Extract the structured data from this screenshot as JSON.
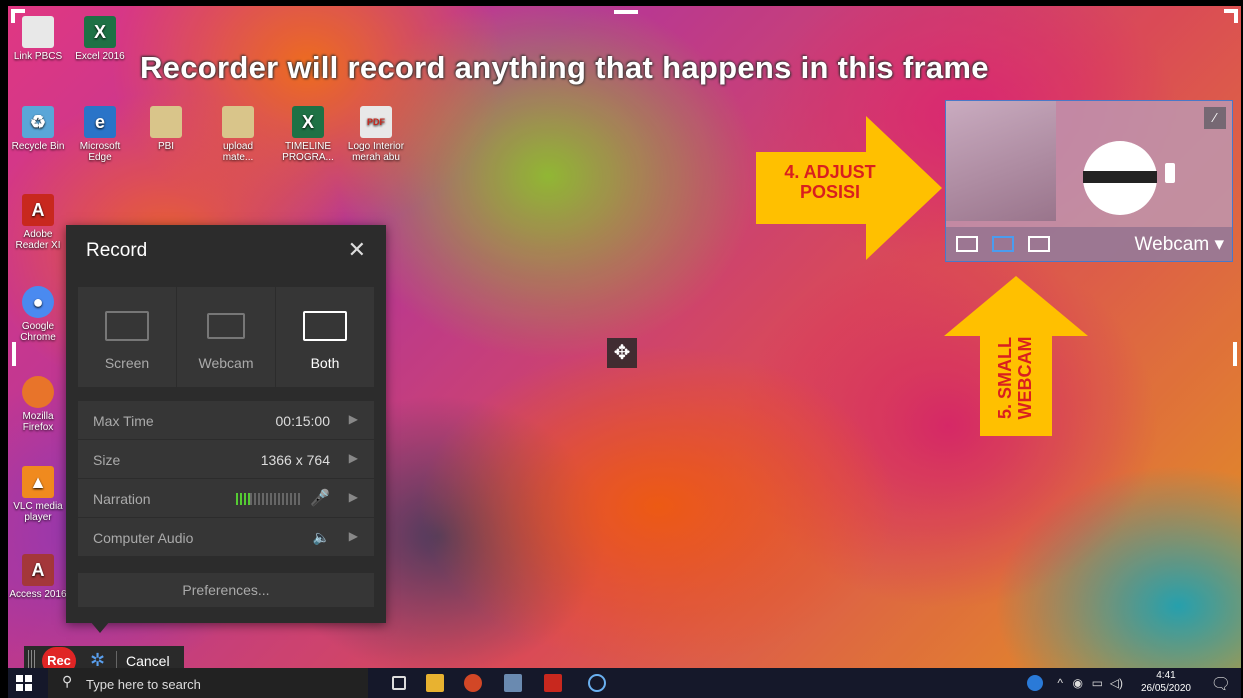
{
  "overlay_hint": "Recorder will record anything that happens in this frame",
  "desktop_icons": [
    {
      "label": "Link PBCS",
      "color": "#e8e8e8"
    },
    {
      "label": "Excel 2016",
      "color": "#1e7145"
    },
    {
      "label": "Recycle Bin",
      "color": "#5aa6d8"
    },
    {
      "label": "Microsoft Edge",
      "color": "#2a74c8"
    },
    {
      "label": "PBI",
      "color": "#d9c58a"
    },
    {
      "label": "upload mate...",
      "color": "#d9c58a"
    },
    {
      "label": "TIMELINE PROGRA...",
      "color": "#1e7145"
    },
    {
      "label": "Logo Interior merah abu",
      "color": "#e8e8e8"
    },
    {
      "label": "Adobe Reader XI",
      "color": "#c8281e"
    },
    {
      "label": "Google Chrome",
      "color": "#4a8af0"
    },
    {
      "label": "Mozilla Firefox",
      "color": "#e8742a"
    },
    {
      "label": "VLC media player",
      "color": "#f08a1e"
    },
    {
      "label": "Access 2016",
      "color": "#a4373a"
    }
  ],
  "webcam_preview": {
    "label": "Webcam",
    "dropdown_glyph": "▾",
    "wand_glyph": "⁄"
  },
  "annotations": {
    "adjust": "4. ADJUST POSISI",
    "small": "5. SMALL WEBCAM",
    "arrow_color": "#ffc000",
    "text_color": "#d91f1f"
  },
  "move_glyph": "✥",
  "record_panel": {
    "title": "Record",
    "close_glyph": "✕",
    "modes": [
      {
        "label": "Screen",
        "selected": false
      },
      {
        "label": "Webcam",
        "selected": false
      },
      {
        "label": "Both",
        "selected": true
      }
    ],
    "rows": [
      {
        "key": "Max Time",
        "value": "00:15:00"
      },
      {
        "key": "Size",
        "value": "1366 x 764"
      },
      {
        "key": "Narration",
        "value": ""
      },
      {
        "key": "Computer Audio",
        "value": ""
      }
    ],
    "chevron_glyph": "▶",
    "mic_glyph": "🎤",
    "speaker_glyph": "🔈",
    "preferences": "Preferences..."
  },
  "rec_bar": {
    "rec": "Rec",
    "gear_glyph": "✲",
    "cancel": "Cancel"
  },
  "taskbar": {
    "search_placeholder": "Type here to search",
    "search_glyph": "⚲",
    "time": "4:41",
    "date": "26/05/2020",
    "notification_glyph": "🗨"
  }
}
